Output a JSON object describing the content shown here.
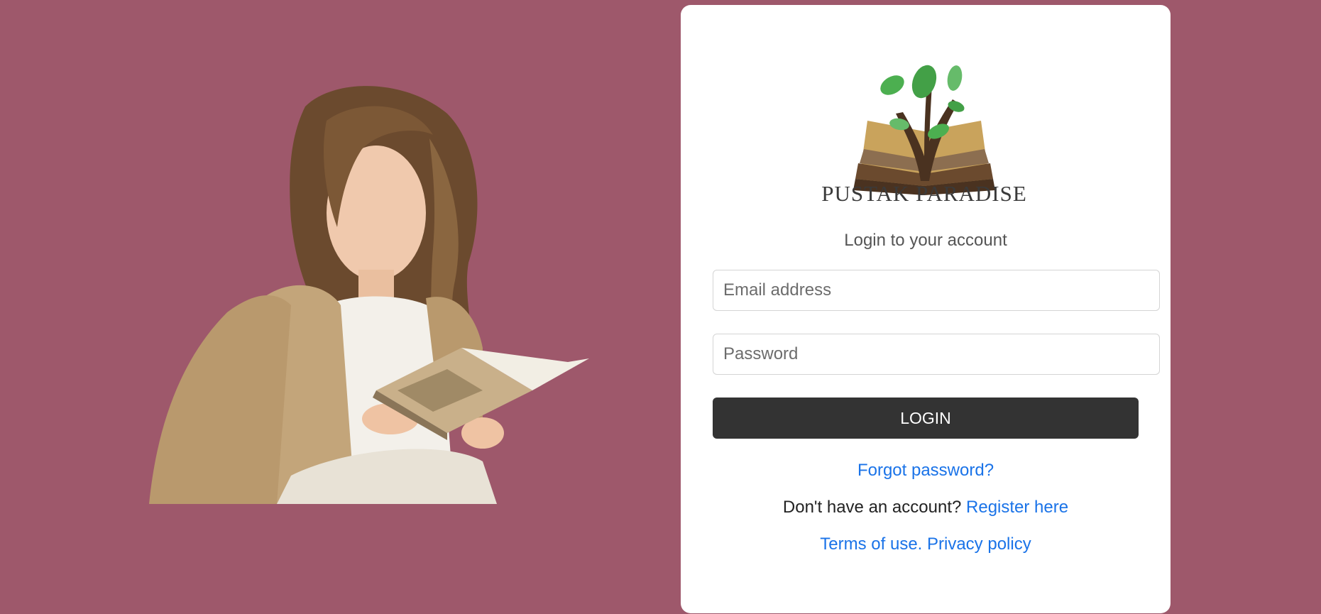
{
  "background_color": "#9e586b",
  "hero": {
    "image": "woman-reading-book-illustration"
  },
  "brand": {
    "logo_icon": "book-tree-logo-icon",
    "name": "PUSTAK PARADISE"
  },
  "login": {
    "subtitle": "Login to your account",
    "email_placeholder": "Email address",
    "password_placeholder": "Password",
    "button_label": "LOGIN",
    "forgot_password": "Forgot password?",
    "no_account_text": "Don't have an account?",
    "register_link": "Register here",
    "terms_link": "Terms of use.",
    "privacy_link": "Privacy policy"
  },
  "colors": {
    "button_bg": "#333333",
    "link": "#1a73e8",
    "card_bg": "#ffffff"
  }
}
